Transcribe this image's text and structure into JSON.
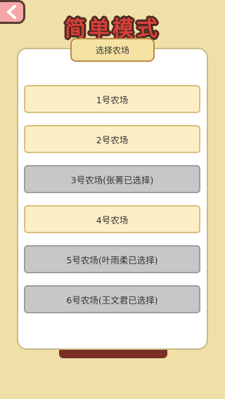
{
  "header": {
    "back_icon": "back-arrow-icon",
    "title": "简单模式"
  },
  "panel": {
    "header_label": "选择农场",
    "farms": [
      {
        "label": "1号农场",
        "state": "available"
      },
      {
        "label": "2号农场",
        "state": "available"
      },
      {
        "label": "3号农场(张菁已选择)",
        "state": "taken"
      },
      {
        "label": "4号农场",
        "state": "available"
      },
      {
        "label": "5号农场(叶雨柔已选择)",
        "state": "taken"
      },
      {
        "label": "6号农场(王文君已选择)",
        "state": "taken"
      }
    ]
  },
  "colors": {
    "background": "#efe0a8",
    "title": "#d93f3a",
    "back_button": "#f4a7a6",
    "available_farm": "#fcefc5",
    "taken_farm": "#c7c7c7"
  }
}
